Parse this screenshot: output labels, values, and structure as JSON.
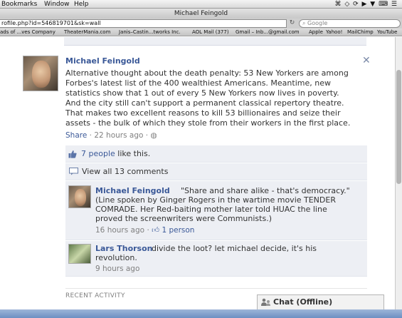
{
  "menubar": {
    "items": [
      "Bookmarks",
      "Window",
      "Help"
    ],
    "tray": "⌘ ◇ ⟳ ▶ ▼ ⌨ ☰"
  },
  "window": {
    "title": "Michael Feingold"
  },
  "toolbar": {
    "url": "rofile.php?id=546819701&sk=wall",
    "search_placeholder": "Google"
  },
  "bookmarks": [
    "ads of ...ves Company",
    "TheaterMania.com",
    "Janis–Castin...tworks Inc.",
    "AOL Mail (377)",
    "Gmail – Inb...@gmail.com",
    "Apple",
    "Yahoo!",
    "MailChimp",
    "YouTube"
  ],
  "post": {
    "author": "Michael Feingold",
    "text_lines": [
      "Alternative thought about the death penalty: 53 New Yorkers are among",
      "Forbes's latest list of the 400 wealthiest Americans. Meantime, new",
      "statistics show that 1 out of every 5 New Yorkers now lives in poverty.",
      "And the city still can't support a permanent classical repertory theatre.",
      "That makes two excellent reasons to kill 53 billionaires and seize their",
      "assets - the bulk of which they stole from their workers in the first place."
    ],
    "share_label": "Share",
    "time": "22 hours ago",
    "sep": "·",
    "close": "✕"
  },
  "likes": {
    "link": "7 people",
    "rest": "like this."
  },
  "comments_toggle": "View all 13 comments",
  "comments": [
    {
      "author": "Michael Feingold",
      "first_line": "\"Share and share alike - that's democracy.\"",
      "lines": [
        "(Line spoken by Ginger Rogers in the wartime movie TENDER",
        "COMRADE. Her Red-baiting mother later told HUAC the line",
        "proved the screenwriters were Communists.)"
      ],
      "time": "16 hours ago",
      "sep": "·",
      "like_count": "1 person"
    },
    {
      "author": "Lars Thorson",
      "first_line": "divide the loot? let michael decide, it's his",
      "lines": [
        "revolution."
      ],
      "time": "9 hours ago"
    }
  ],
  "recent_activity": "RECENT ACTIVITY",
  "chat": {
    "label": "Chat (Offline)"
  },
  "colors": {
    "link": "#3b5998",
    "ufi_bg": "#edeff4",
    "meta": "#808080"
  }
}
